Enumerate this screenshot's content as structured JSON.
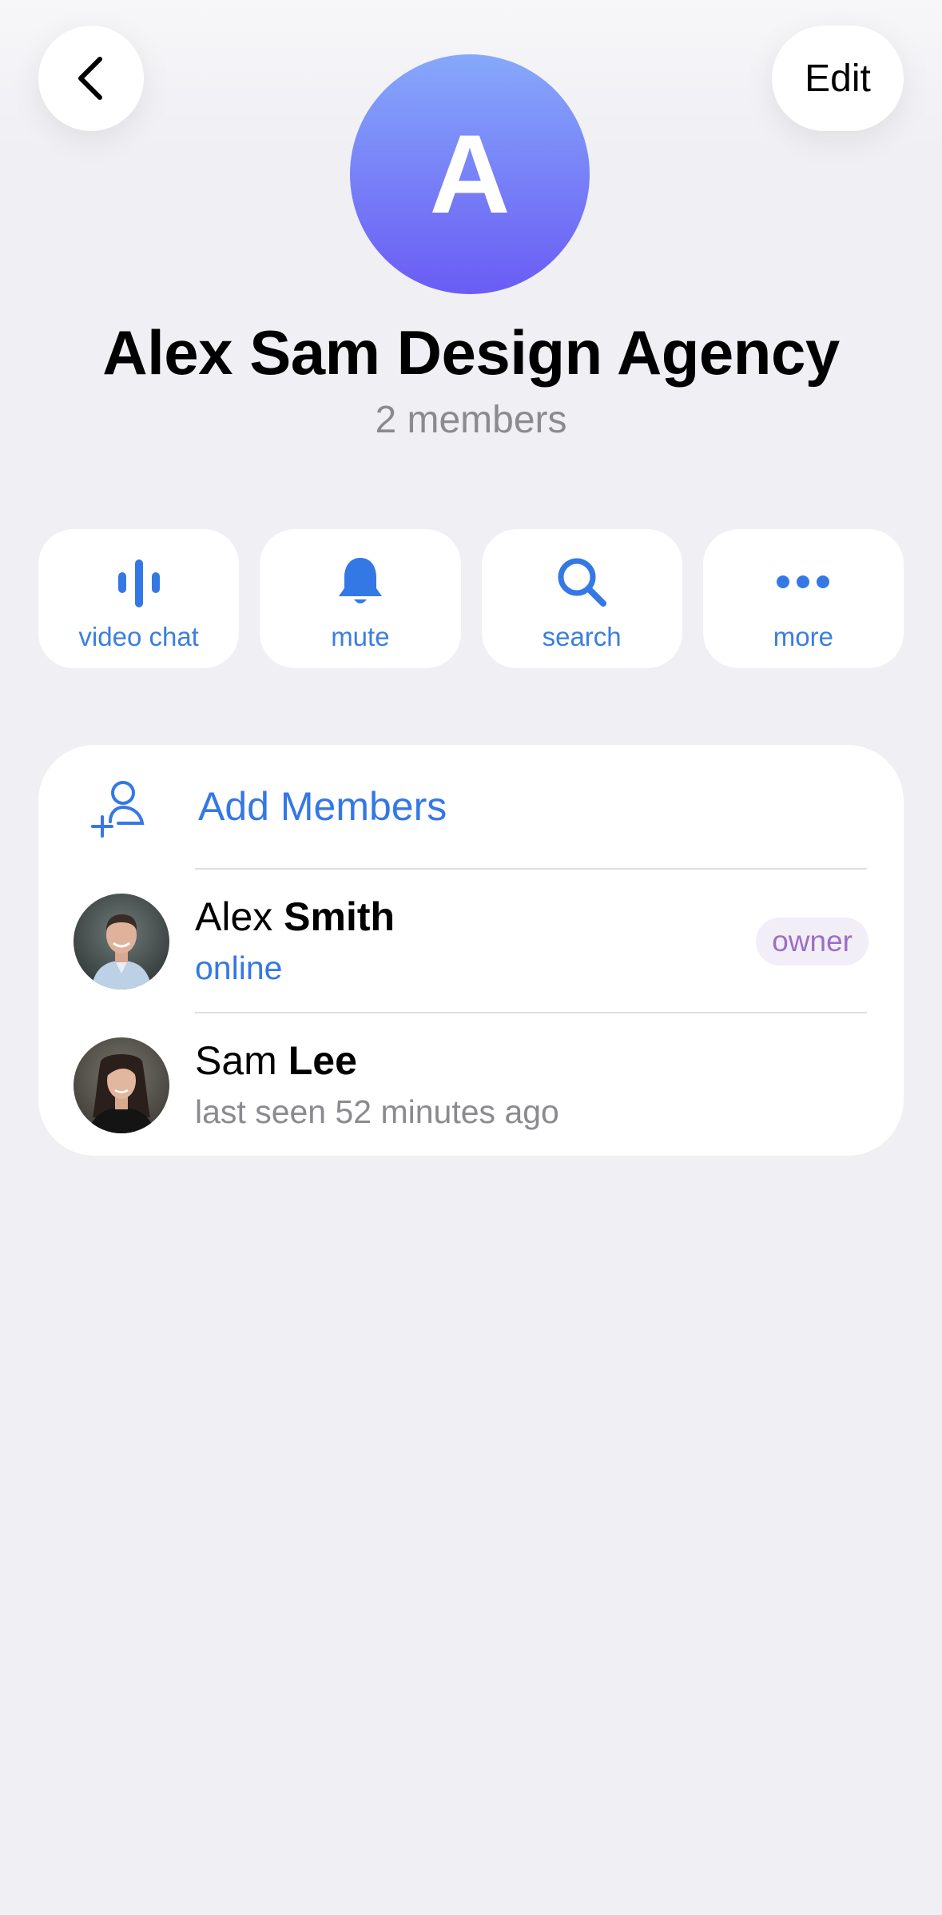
{
  "header": {
    "back_icon": "chevron-left-icon",
    "edit_label": "Edit"
  },
  "group": {
    "avatar_letter": "A",
    "title": "Alex Sam Design Agency",
    "subtitle": "2 members",
    "avatar_gradient": [
      "#86a8fb",
      "#6a5cf4"
    ]
  },
  "actions": [
    {
      "label": "video chat",
      "icon": "sound-bars-icon"
    },
    {
      "label": "mute",
      "icon": "bell-icon"
    },
    {
      "label": "search",
      "icon": "search-icon"
    },
    {
      "label": "more",
      "icon": "more-dots-icon"
    }
  ],
  "members_card": {
    "add_label": "Add Members",
    "add_icon": "add-person-icon",
    "members": [
      {
        "first": "Alex",
        "last": "Smith",
        "status": "online",
        "badge": "owner"
      },
      {
        "first": "Sam",
        "last": "Lee",
        "status": "last seen 52 minutes ago"
      }
    ]
  },
  "colors": {
    "accent": "#3478e6",
    "background": "#efeff4",
    "badge_text": "#9b6fc6",
    "badge_bg": "#f2eef8"
  }
}
